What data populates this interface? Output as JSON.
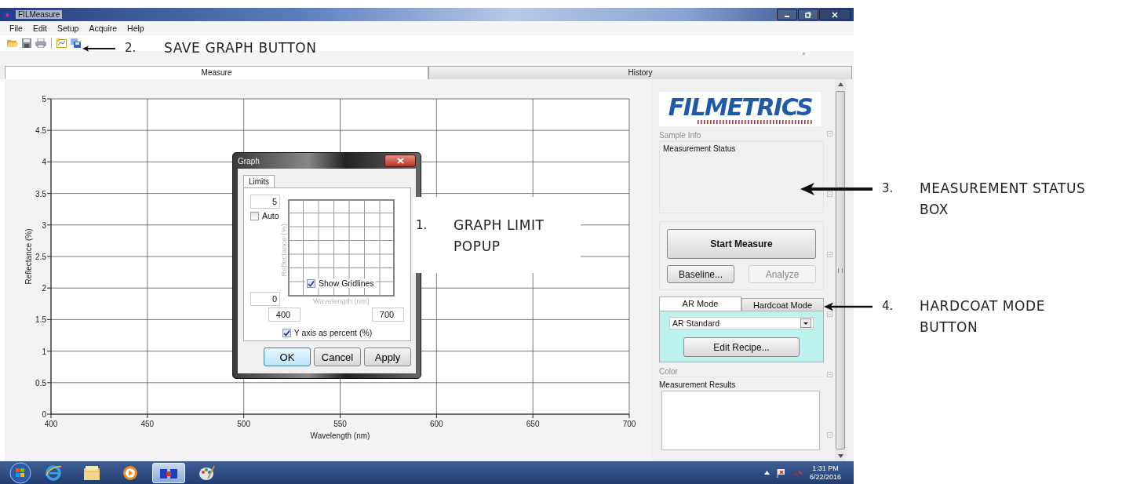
{
  "window": {
    "title": "FILMeasure"
  },
  "menu": [
    "File",
    "Edit",
    "Setup",
    "Acquire",
    "Help"
  ],
  "tabs": [
    {
      "label": "Measure",
      "selected": true
    },
    {
      "label": "History",
      "selected": false
    }
  ],
  "chart": {
    "chart_data": {
      "type": "line",
      "grid": true,
      "xlabel": "Wavelength (nm)",
      "ylabel": "Reflectance (%)",
      "xlim": [
        400,
        700
      ],
      "ylim": [
        0,
        5
      ],
      "xticks": [
        400,
        450,
        500,
        550,
        600,
        650,
        700
      ],
      "yticks": [
        0,
        0.5,
        1,
        1.5,
        2,
        2.5,
        3,
        3.5,
        4,
        4.5,
        5
      ]
    }
  },
  "dialog": {
    "title": "Graph",
    "tabs": [
      {
        "label": "Limits",
        "selected": true
      }
    ],
    "y_max": "5",
    "auto": {
      "label": "Auto",
      "checked": false
    },
    "preview_ylabel": "Reflectance (%)",
    "show_gridlines": {
      "label": "Show Gridlines",
      "checked": true
    },
    "y_min": "0",
    "preview_xlabel": "Wavelength (nm)",
    "x_min": "400",
    "x_max": "700",
    "percent": {
      "label": "Y axis as percent (%)",
      "checked": true
    },
    "buttons": [
      "OK",
      "Cancel",
      "Apply"
    ]
  },
  "side_panel": {
    "logo": "FILMETRICS",
    "sample_heading": "Sample Info",
    "status_label": "Measurement Status",
    "start_button": "Start Measure",
    "actions": [
      {
        "label": "Baseline...",
        "disabled": false
      },
      {
        "label": "Analyze",
        "disabled": true
      }
    ],
    "mode_tabs": [
      {
        "label": "AR Mode",
        "selected": true
      },
      {
        "label": "Hardcoat Mode",
        "selected": false
      }
    ],
    "recipe": "AR Standard",
    "edit_recipe": "Edit Recipe...",
    "color_heading": "Color",
    "results_label": "Measurement Results"
  },
  "taskbar": {
    "apps": [
      {
        "kind": "browser",
        "selected": false
      },
      {
        "kind": "folder",
        "selected": false
      },
      {
        "kind": "media",
        "selected": false
      },
      {
        "kind": "app",
        "selected": true
      },
      {
        "kind": "paint",
        "selected": false
      }
    ],
    "time": "1:31 PM",
    "date": "6/22/2016"
  },
  "annotations": [
    {
      "number": "2.",
      "lines": [
        "SAVE GRAPH BUTTON"
      ]
    },
    {
      "number": "1.",
      "lines": [
        "GRAPH LIMIT",
        "POPUP"
      ]
    },
    {
      "number": "3.",
      "lines": [
        "MEASUREMENT STATUS",
        "BOX"
      ]
    },
    {
      "number": "4.",
      "lines": [
        "HARDCOAT MODE",
        "BUTTON"
      ]
    }
  ]
}
